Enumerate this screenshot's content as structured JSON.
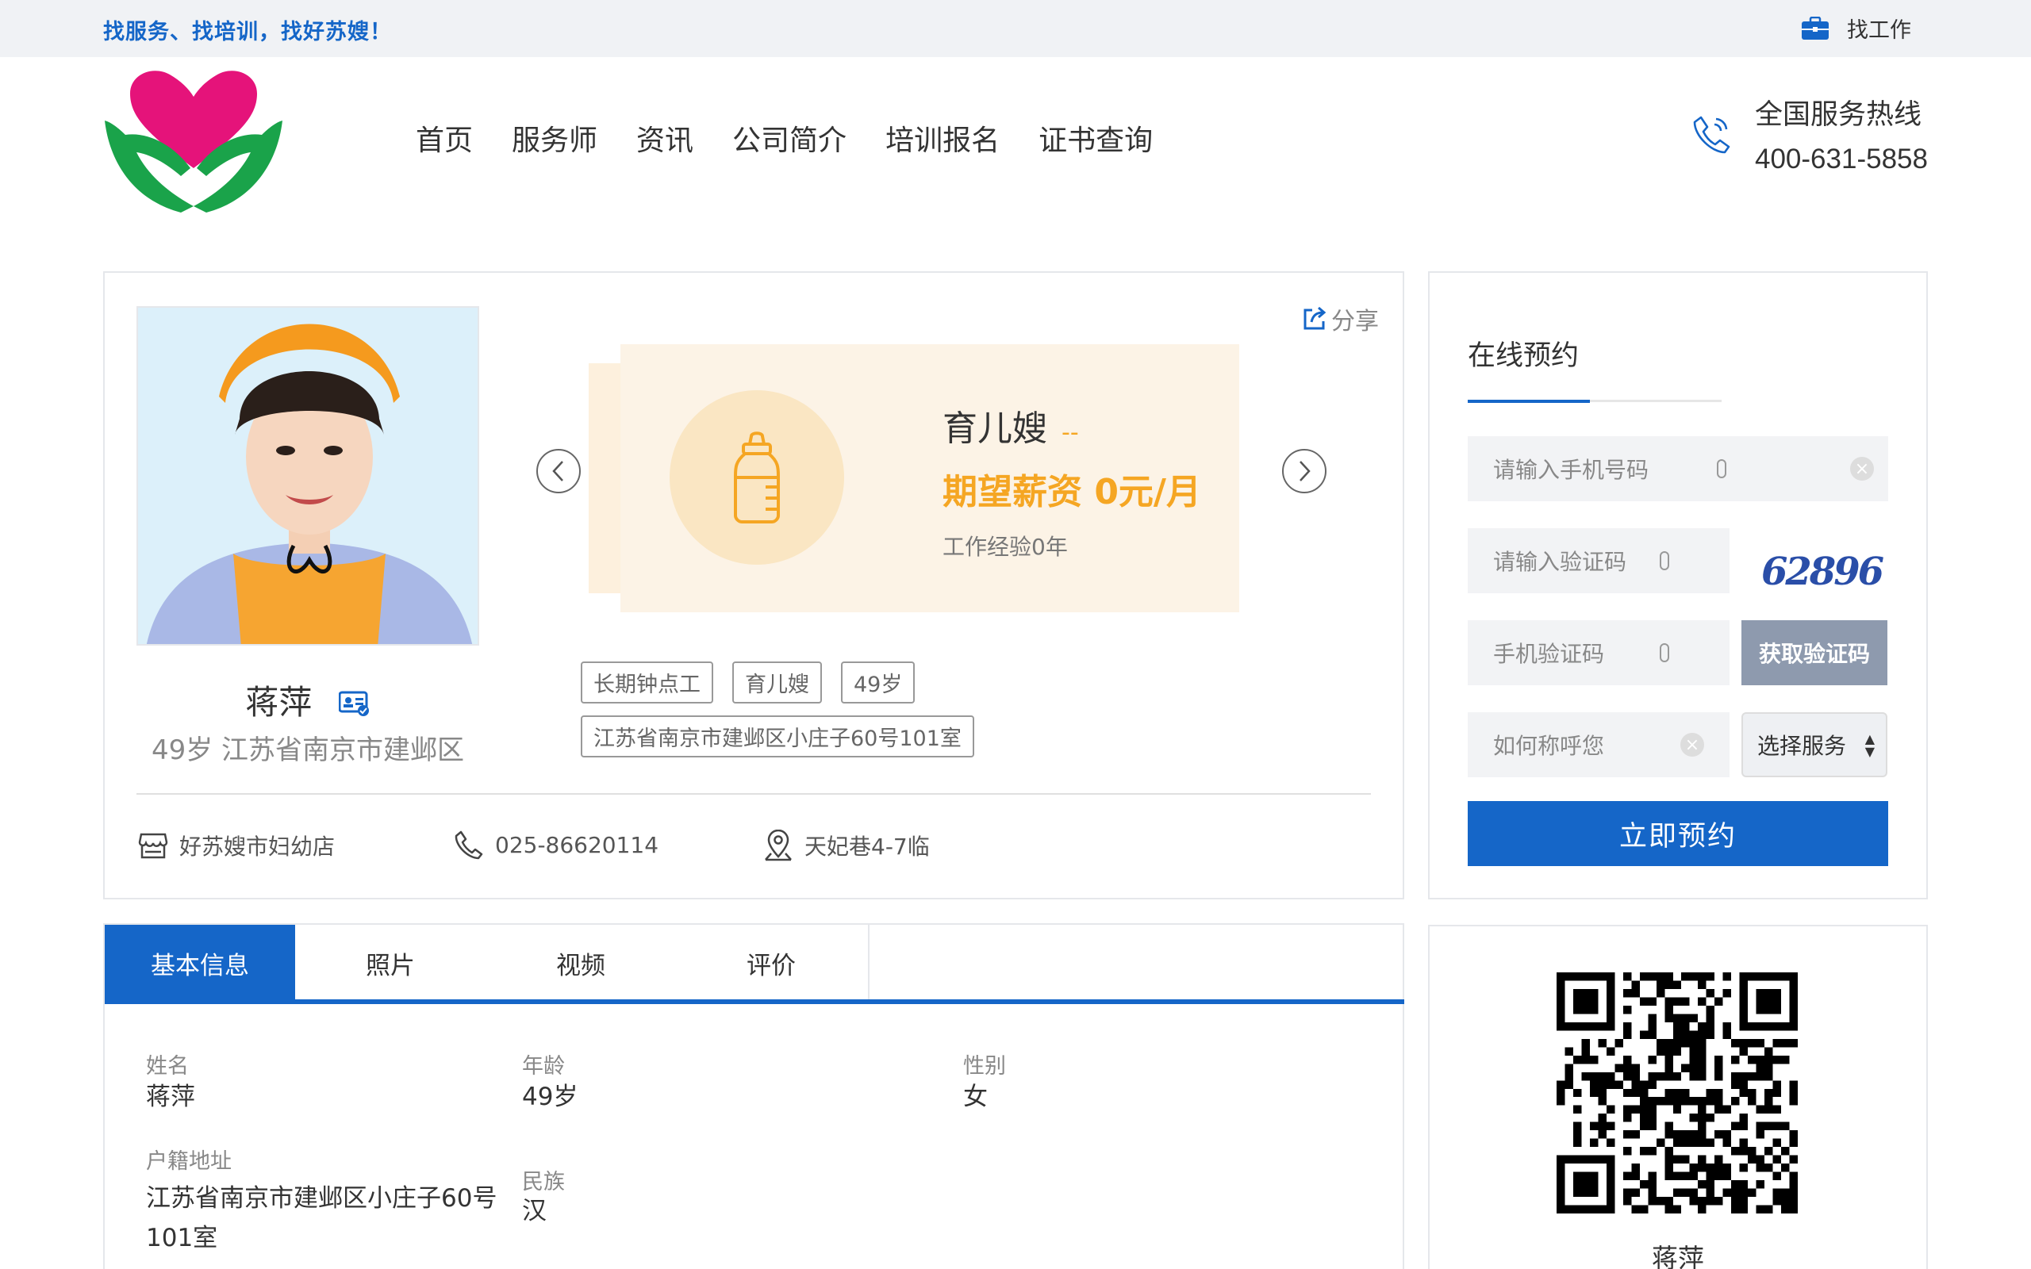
{
  "topbar": {
    "slogan": "找服务、找培训，找好苏嫂！",
    "job_label": "找工作"
  },
  "nav": {
    "items": [
      "首页",
      "服务师",
      "资讯",
      "公司简介",
      "培训报名",
      "证书查询"
    ]
  },
  "hotline": {
    "label": "全国服务热线",
    "number": "400-631-5858"
  },
  "profile": {
    "name": "蒋萍",
    "meta": "49岁 江苏省南京市建邺区",
    "share_label": "分享",
    "card": {
      "role": "育儿嫂",
      "role_suffix": "--",
      "salary": "期望薪资 0元/月",
      "experience": "工作经验0年"
    },
    "tags": [
      "长期钟点工",
      "育儿嫂",
      "49岁"
    ],
    "address_tag": "江苏省南京市建邺区小庄子60号101室",
    "store": "好苏嫂市妇幼店",
    "phone": "025-86620114",
    "location": "天妃巷4-7临"
  },
  "booking": {
    "title": "在线预约",
    "phone_placeholder": "请输入手机号码",
    "captcha_placeholder": "请输入验证码",
    "captcha_text": "62896",
    "sms_placeholder": "手机验证码",
    "sms_button": "获取验证码",
    "name_placeholder": "如何称呼您",
    "service_select": "选择服务",
    "submit": "立即预约"
  },
  "tabs": [
    "基本信息",
    "照片",
    "视频",
    "评价"
  ],
  "basic_info": {
    "name_label": "姓名",
    "name": "蒋萍",
    "age_label": "年龄",
    "age": "49岁",
    "gender_label": "性别",
    "gender": "女",
    "hukou_label": "户籍地址",
    "hukou": "江苏省南京市建邺区小庄子60号101室",
    "ethnicity_label": "民族",
    "ethnicity": "汉"
  },
  "qr": {
    "name": "蒋萍"
  },
  "colors": {
    "primary": "#1566c8",
    "accent": "#f5a623",
    "logo_heart": "#e5137a",
    "logo_hands": "#1aa34a"
  }
}
